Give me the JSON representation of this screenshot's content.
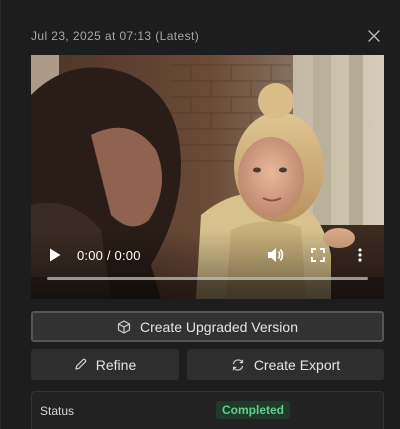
{
  "header": {
    "title": "Jul 23, 2025 at 07:13 (Latest)",
    "close_icon": "close-icon"
  },
  "video": {
    "time_display": "0:00 / 0:00",
    "progress": 0,
    "icons": [
      "play-icon",
      "volume-icon",
      "fullscreen-icon",
      "more-vertical-icon"
    ]
  },
  "actions": {
    "upgrade_label": "Create Upgraded Version",
    "upgrade_icon": "cube-icon",
    "refine_label": "Refine",
    "refine_icon": "pencil-icon",
    "export_label": "Create Export",
    "export_icon": "refresh-icon"
  },
  "status": {
    "label": "Status",
    "value": "Completed",
    "badge_color": "#5fcf8a",
    "badge_bg": "#1f3a2a"
  }
}
